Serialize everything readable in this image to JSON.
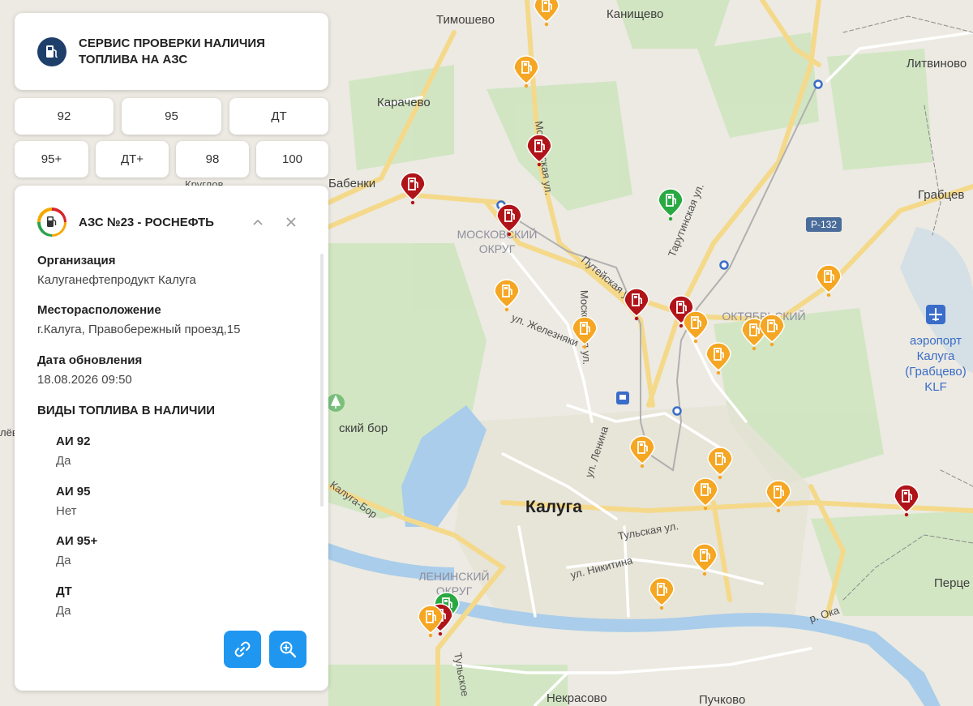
{
  "app": {
    "title": "СЕРВИС ПРОВЕРКИ НАЛИЧИЯ ТОПЛИВА НА АЗС"
  },
  "filters": {
    "row1": [
      "92",
      "95",
      "ДТ"
    ],
    "row2": [
      "95+",
      "ДТ+",
      "98",
      "100"
    ]
  },
  "station": {
    "title": "АЗС №23 - РОСНЕФТЬ",
    "org_label": "Организация",
    "org_value": "Калуганефтепродукт Калуга",
    "loc_label": "Месторасположение",
    "loc_value": "г.Калуга, Правобережный проезд,15",
    "date_label": "Дата обновления",
    "date_value": "18.08.2026 09:50",
    "fuels_heading": "ВИДЫ ТОПЛИВА В НАЛИЧИИ",
    "fuels": [
      {
        "name": "АИ 92",
        "status": "Да"
      },
      {
        "name": "АИ 95",
        "status": "Нет"
      },
      {
        "name": "АИ 95+",
        "status": "Да"
      },
      {
        "name": "ДТ",
        "status": "Да"
      }
    ]
  },
  "map": {
    "labels": {
      "timoshevo": "Тимошево",
      "kanishchevo": "Канищево",
      "litvinovo": "Литвиново",
      "karachevo": "Карачево",
      "babenki": "Бабенки",
      "grabtsevo": "Грабцев",
      "moskovsky1": "МОСКОВСКИЙ",
      "moskovsky2": "ОКРУГ",
      "oktyabrsky": "ОКТЯБРЬСКИЙ",
      "moskovskaya1": "Московская ул.",
      "moskovskaya2": "Московская ул.",
      "tarutinskaya": "Тарутинская ул.",
      "puteyskaya": "Путейская ул.",
      "zheleznyaki": "ул. Железняки",
      "lenina": "ул. Ленина",
      "bor": "ский бор",
      "kaluga_bor": "Калуга-Бор",
      "kaluga": "Калуга",
      "tulskaya": "Тульская ул.",
      "nikitina": "ул. Никитина",
      "leninsky1": "ЛЕНИНСКИЙ",
      "leninsky2": "ОКРУГ",
      "airport1": "аэропорт",
      "airport2": "Калуга",
      "airport3": "(Грабцево)",
      "airport4": "KLF",
      "r132": "Р-132",
      "oka": "р. Ока",
      "pertsevo": "Перце",
      "nekrasovo": "Некрасово",
      "puchkovo": "Пучково",
      "tulskoe": "Тульское",
      "kruglov": "Круглов",
      "olyo": "лёв"
    },
    "marker_colors": {
      "available": "#2aa842",
      "partial": "#f5a623",
      "unavailable": "#b01419"
    },
    "markers": [
      {
        "status": "partial"
      },
      {
        "status": "partial"
      },
      {
        "status": "unavailable"
      },
      {
        "status": "unavailable"
      },
      {
        "status": "unavailable"
      },
      {
        "status": "available"
      },
      {
        "status": "partial"
      },
      {
        "status": "partial"
      },
      {
        "status": "unavailable"
      },
      {
        "status": "unavailable"
      },
      {
        "status": "partial"
      },
      {
        "status": "partial"
      },
      {
        "status": "partial"
      },
      {
        "status": "partial"
      },
      {
        "status": "partial"
      },
      {
        "status": "partial"
      },
      {
        "status": "partial"
      },
      {
        "status": "partial"
      },
      {
        "status": "partial"
      },
      {
        "status": "unavailable"
      },
      {
        "status": "partial"
      },
      {
        "status": "partial"
      },
      {
        "status": "available"
      },
      {
        "status": "unavailable"
      },
      {
        "status": "partial"
      }
    ]
  },
  "actions": {
    "link_icon": "link-icon",
    "zoom_icon": "zoom-in-icon"
  }
}
